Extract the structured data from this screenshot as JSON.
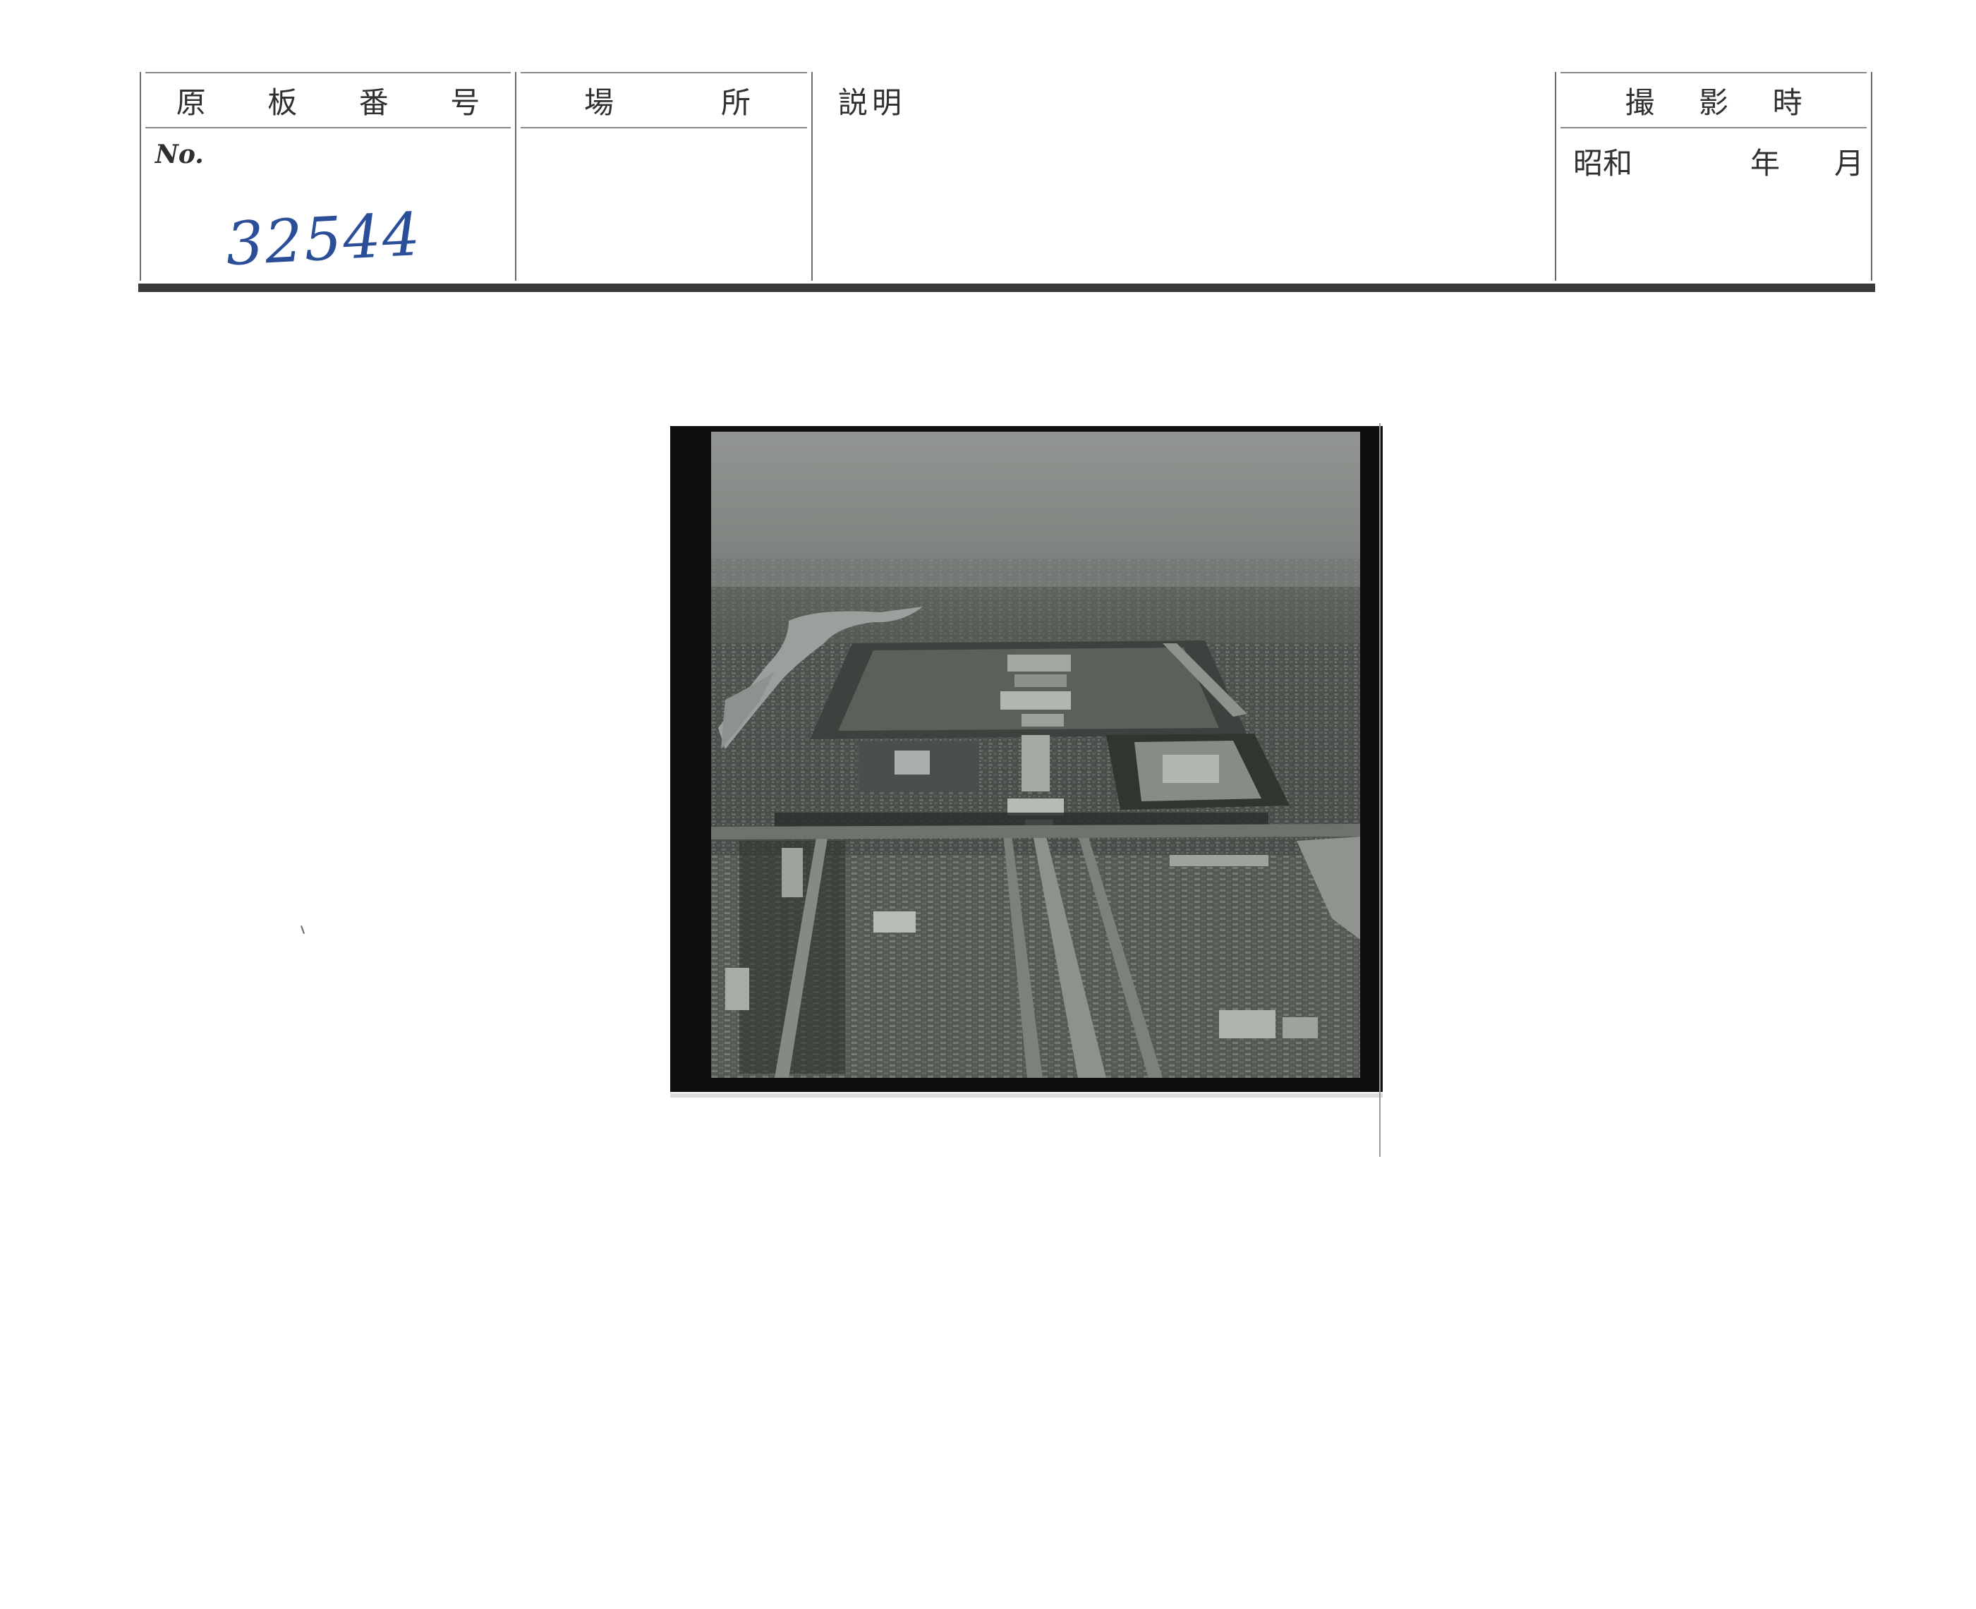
{
  "form": {
    "plate_header": [
      "原",
      "板",
      "番",
      "号"
    ],
    "location_header": [
      "場",
      "所"
    ],
    "description_label": "説明",
    "date_header": [
      "撮",
      "影",
      "時"
    ],
    "no_label": "No.",
    "plate_number": "32544",
    "date_era": "昭和",
    "year_label": "年",
    "month_label": "月"
  },
  "photo": {
    "subject": "aerial-photograph"
  }
}
